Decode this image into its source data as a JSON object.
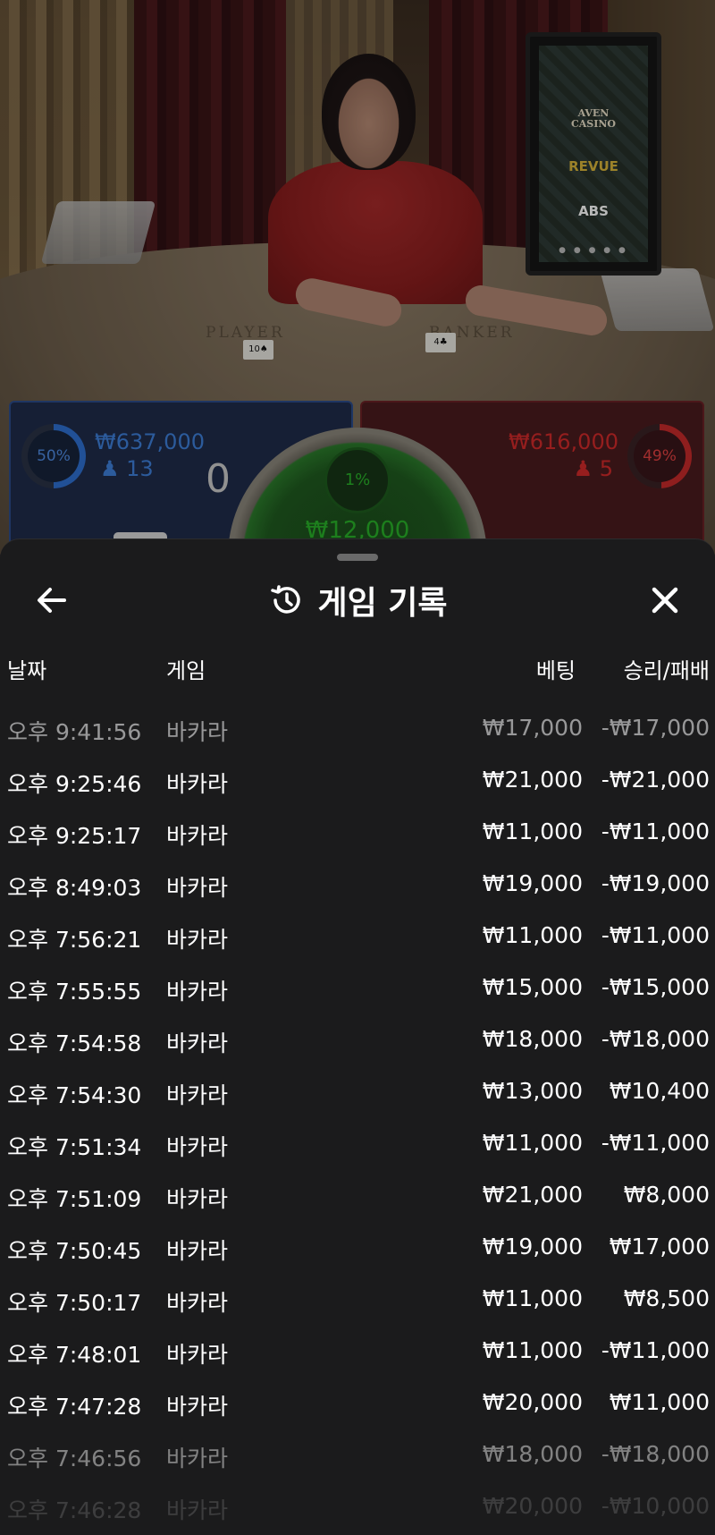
{
  "stream": {
    "table_labels": {
      "player": "PLAYER",
      "banker": "BANKER"
    },
    "cards": {
      "player": "10♠",
      "banker": "4♣"
    },
    "sponsors": [
      "AVEN\nCASINO",
      "REVUE",
      "ABS"
    ],
    "dots": "● ● ● ● ●"
  },
  "bets": {
    "player": {
      "percent": "50%",
      "amount": "₩637,000",
      "players": "13",
      "score": "0"
    },
    "banker": {
      "percent": "49%",
      "amount": "₩616,000",
      "players": "5"
    },
    "tie": {
      "percent": "1%",
      "amount": "₩12,000"
    }
  },
  "history": {
    "title": "게임 기록",
    "columns": {
      "date": "날짜",
      "game": "게임",
      "bet": "베팅",
      "win_loss": "승리/패배"
    },
    "rows": [
      {
        "time": "오후 9:41:56",
        "game": "바카라",
        "bet": "₩17,000",
        "result": "-₩17,000"
      },
      {
        "time": "오후 9:25:46",
        "game": "바카라",
        "bet": "₩21,000",
        "result": "-₩21,000"
      },
      {
        "time": "오후 9:25:17",
        "game": "바카라",
        "bet": "₩11,000",
        "result": "-₩11,000"
      },
      {
        "time": "오후 8:49:03",
        "game": "바카라",
        "bet": "₩19,000",
        "result": "-₩19,000"
      },
      {
        "time": "오후 7:56:21",
        "game": "바카라",
        "bet": "₩11,000",
        "result": "-₩11,000"
      },
      {
        "time": "오후 7:55:55",
        "game": "바카라",
        "bet": "₩15,000",
        "result": "-₩15,000"
      },
      {
        "time": "오후 7:54:58",
        "game": "바카라",
        "bet": "₩18,000",
        "result": "-₩18,000"
      },
      {
        "time": "오후 7:54:30",
        "game": "바카라",
        "bet": "₩13,000",
        "result": "₩10,400"
      },
      {
        "time": "오후 7:51:34",
        "game": "바카라",
        "bet": "₩11,000",
        "result": "-₩11,000"
      },
      {
        "time": "오후 7:51:09",
        "game": "바카라",
        "bet": "₩21,000",
        "result": "₩8,000"
      },
      {
        "time": "오후 7:50:45",
        "game": "바카라",
        "bet": "₩19,000",
        "result": "₩17,000"
      },
      {
        "time": "오후 7:50:17",
        "game": "바카라",
        "bet": "₩11,000",
        "result": "₩8,500"
      },
      {
        "time": "오후 7:48:01",
        "game": "바카라",
        "bet": "₩11,000",
        "result": "-₩11,000"
      },
      {
        "time": "오후 7:47:28",
        "game": "바카라",
        "bet": "₩20,000",
        "result": "₩11,000"
      },
      {
        "time": "오후 7:46:56",
        "game": "바카라",
        "bet": "₩18,000",
        "result": "-₩18,000"
      },
      {
        "time": "오후 7:46:28",
        "game": "바카라",
        "bet": "₩20,000",
        "result": "-₩10,000"
      }
    ]
  },
  "icons": {
    "back": "arrow-left-icon",
    "history": "history-clock-icon",
    "close": "close-x-icon"
  }
}
